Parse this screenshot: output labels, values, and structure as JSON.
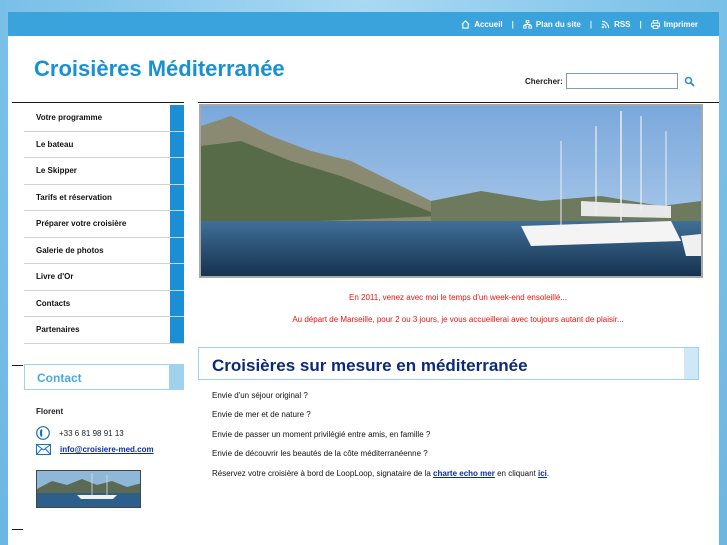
{
  "topnav": {
    "items": [
      {
        "label": "Accueil",
        "icon": "home-icon"
      },
      {
        "label": "Plan du site",
        "icon": "sitemap-icon"
      },
      {
        "label": "RSS",
        "icon": "rss-icon"
      },
      {
        "label": "Imprimer",
        "icon": "print-icon"
      }
    ],
    "separator": "|"
  },
  "site_title": "Croisières Méditerranée",
  "search": {
    "label": "Chercher:",
    "value": "",
    "placeholder": ""
  },
  "sidebar": {
    "items": [
      {
        "label": "Votre programme"
      },
      {
        "label": "Le bateau"
      },
      {
        "label": "Le Skipper"
      },
      {
        "label": "Tarifs et réservation"
      },
      {
        "label": "Préparer votre croisière"
      },
      {
        "label": "Galerie de photos"
      },
      {
        "label": "Livre d'Or"
      },
      {
        "label": "Contacts"
      },
      {
        "label": "Partenaires"
      }
    ]
  },
  "contact": {
    "title": "Contact",
    "name": "Florent",
    "phone": "+33 6 81 98 91 13",
    "email": "info@croisiere-med.com"
  },
  "tagline": {
    "line1": "En 2011, venez avec moi le temps d'un week-end ensoleillé...",
    "line2": "Au départ de Marseille, pour 2 ou 3 jours, je vous accueillerai avec toujours autant de plaisir..."
  },
  "section": {
    "heading": "Croisières sur mesure en méditerranée",
    "lines": [
      "Envie d'un séjour original ?",
      "Envie de mer et de nature ?",
      "Envie de passer un moment privilégié entre amis, en famille ?",
      "Envie de découvrir les beautés de la côte méditerranéenne ?"
    ],
    "cta_before": "Réservez votre croisière à bord de LoopLoop, signataire de la ",
    "cta_link1": "charte echo mer",
    "cta_middle": " en cliquant ",
    "cta_link2": "ici",
    "cta_after": "."
  },
  "colors": {
    "accent": "#1a91cf",
    "nav_tab": "#1a8fd6",
    "heading": "#0b2a7a",
    "tagline": "#e8140f"
  }
}
